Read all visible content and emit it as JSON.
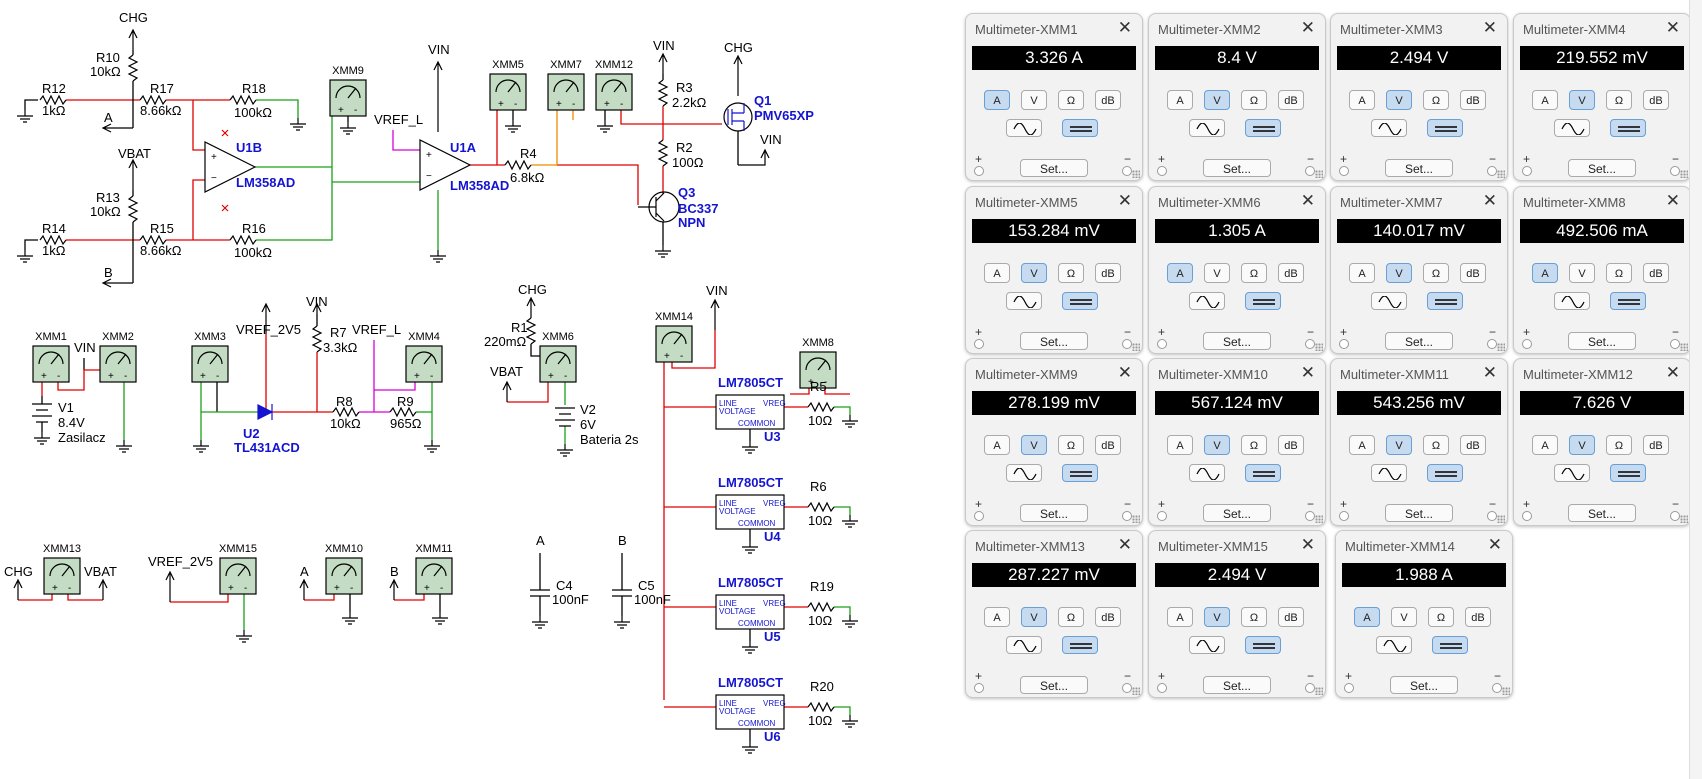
{
  "schematic": {
    "nets": {
      "chg": "CHG",
      "vbat": "VBAT",
      "vin": "VIN",
      "a": "A",
      "b": "B",
      "vref_l": "VREF_L",
      "vref_2v5": "VREF_2V5"
    },
    "components": {
      "r10": [
        "R10",
        "10kΩ"
      ],
      "r12": [
        "R12",
        "1kΩ"
      ],
      "r17": [
        "R17",
        "8.66kΩ"
      ],
      "r18": [
        "R18",
        "100kΩ"
      ],
      "r13": [
        "R13",
        "10kΩ"
      ],
      "r14": [
        "R14",
        "1kΩ"
      ],
      "r15": [
        "R15",
        "8.66kΩ"
      ],
      "r16": [
        "R16",
        "100kΩ"
      ],
      "u1b": [
        "U1B",
        "LM358AD"
      ],
      "u1a": [
        "U1A",
        "LM358AD"
      ],
      "r4": [
        "R4",
        "6.8kΩ"
      ],
      "r3": [
        "R3",
        "2.2kΩ"
      ],
      "r2": [
        "R2",
        "100Ω"
      ],
      "q1": [
        "Q1",
        "PMV65XP"
      ],
      "q3": [
        "Q3",
        "BC337",
        "NPN"
      ],
      "v1": [
        "V1",
        "8.4V",
        "Zasilacz"
      ],
      "r7": [
        "R7",
        "3.3kΩ"
      ],
      "u2": [
        "U2",
        "TL431ACD"
      ],
      "r8": [
        "R8",
        "10kΩ"
      ],
      "r9": [
        "R9",
        "965Ω"
      ],
      "r1": [
        "R1",
        "220mΩ"
      ],
      "v2": [
        "V2",
        "6V",
        "Bateria 2s"
      ],
      "c4": [
        "C4",
        "100nF"
      ],
      "c5": [
        "C5",
        "100nF"
      ],
      "r5": [
        "R5",
        "10Ω"
      ],
      "r6": [
        "R6",
        "10Ω"
      ],
      "r19": [
        "R19",
        "10Ω"
      ],
      "r20": [
        "R20",
        "10Ω"
      ],
      "reg_part": "LM7805CT",
      "reg_line": "LINE",
      "reg_voltage": "VOLTAGE",
      "reg_vreg": "VREG",
      "reg_common": "COMMON",
      "u3": "U3",
      "u4": "U4",
      "u5": "U5",
      "u6": "U6"
    },
    "meters": [
      "XMM9",
      "XMM5",
      "XMM7",
      "XMM12",
      "XMM1",
      "XMM2",
      "XMM3",
      "XMM4",
      "XMM6",
      "XMM14",
      "XMM8",
      "XMM13",
      "XMM15",
      "XMM10",
      "XMM11"
    ]
  },
  "multimeters": [
    {
      "title": "Multimeter-XMM1",
      "value": "3.326 A",
      "mode": "A"
    },
    {
      "title": "Multimeter-XMM2",
      "value": "8.4 V",
      "mode": "V"
    },
    {
      "title": "Multimeter-XMM3",
      "value": "2.494 V",
      "mode": "V"
    },
    {
      "title": "Multimeter-XMM4",
      "value": "219.552 mV",
      "mode": "V"
    },
    {
      "title": "Multimeter-XMM5",
      "value": "153.284 mV",
      "mode": "V"
    },
    {
      "title": "Multimeter-XMM6",
      "value": "1.305 A",
      "mode": "A"
    },
    {
      "title": "Multimeter-XMM7",
      "value": "140.017 mV",
      "mode": "V"
    },
    {
      "title": "Multimeter-XMM8",
      "value": "492.506 mA",
      "mode": "A"
    },
    {
      "title": "Multimeter-XMM9",
      "value": "278.199 mV",
      "mode": "V"
    },
    {
      "title": "Multimeter-XMM10",
      "value": "567.124 mV",
      "mode": "V"
    },
    {
      "title": "Multimeter-XMM11",
      "value": "543.256 mV",
      "mode": "V"
    },
    {
      "title": "Multimeter-XMM12",
      "value": "7.626 V",
      "mode": "V"
    },
    {
      "title": "Multimeter-XMM13",
      "value": "287.227 mV",
      "mode": "V"
    },
    {
      "title": "Multimeter-XMM15",
      "value": "2.494 V",
      "mode": "V"
    },
    {
      "title": "Multimeter-XMM14",
      "value": "1.988 A",
      "mode": "A"
    }
  ],
  "meter_ui": {
    "close": "✕",
    "modes": [
      "A",
      "V",
      "Ω",
      "dB"
    ],
    "set": "Set...",
    "plus": "+",
    "minus": "−",
    "ac_icon": "sine-wave-icon",
    "dc_icon": "dc-line-icon"
  },
  "colors": {
    "wire_red": "#e00000",
    "wire_green": "#1aa01a",
    "wire_orange": "#f08a00",
    "wire_magenta": "#d800d8",
    "wire_black": "#000000",
    "label_blue": "#1414d0",
    "meter_fill": "#c4dcc4",
    "active_button": "#c6dbf0"
  }
}
